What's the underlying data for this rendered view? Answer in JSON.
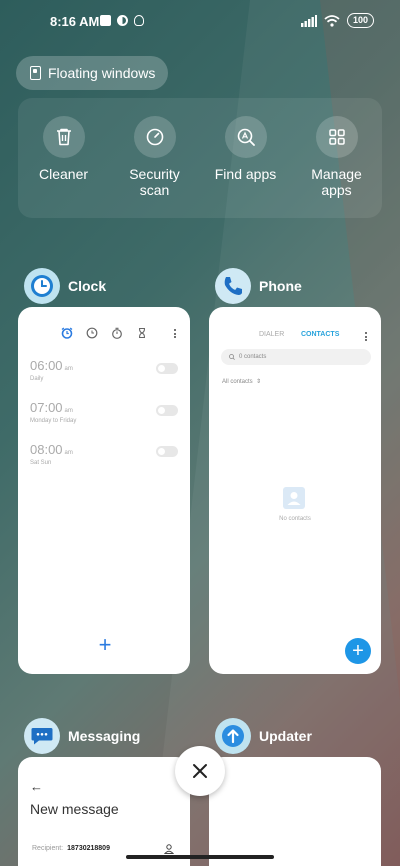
{
  "status_bar": {
    "time": "8:16 AM",
    "battery": "100"
  },
  "floating_windows": {
    "label": "Floating windows"
  },
  "quick_actions": [
    {
      "label": "Cleaner",
      "icon": "trash-icon"
    },
    {
      "label": "Security\nscan",
      "icon": "gauge-icon"
    },
    {
      "label": "Find apps",
      "icon": "search-apps-icon"
    },
    {
      "label": "Manage\napps",
      "icon": "grid-icon"
    }
  ],
  "apps": {
    "clock": {
      "name": "Clock",
      "alarms": [
        {
          "time": "06:00",
          "ampm": "am",
          "repeat": "Daily"
        },
        {
          "time": "07:00",
          "ampm": "am",
          "repeat": "Monday to Friday"
        },
        {
          "time": "08:00",
          "ampm": "am",
          "repeat": "Sat Sun"
        }
      ]
    },
    "phone": {
      "name": "Phone",
      "tabs": {
        "dialer": "DIALER",
        "contacts": "CONTACTS"
      },
      "search_placeholder": "0 contacts",
      "filter": "All contacts",
      "empty": "No contacts"
    },
    "messaging": {
      "name": "Messaging",
      "title": "New message",
      "recipient_label": "Recipient:",
      "recipient_value": "18730218809"
    },
    "updater": {
      "name": "Updater"
    }
  },
  "colors": {
    "accent": "#1e96e6",
    "contacts_tab": "#28a3dc",
    "alarm_icon": "#2b7be0"
  }
}
